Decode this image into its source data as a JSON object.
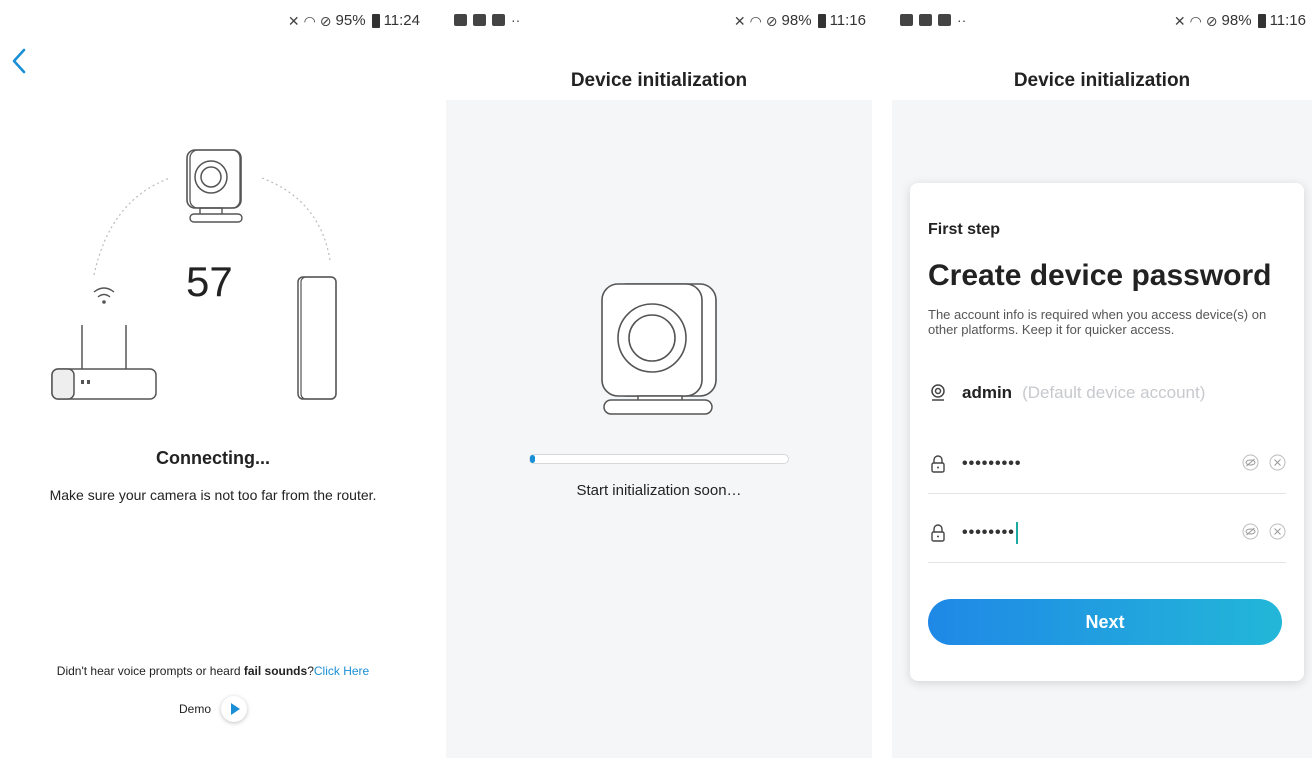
{
  "screen1": {
    "status": {
      "battery": "95%",
      "time": "11:24"
    },
    "countdown": "57",
    "connecting": "Connecting...",
    "hint": "Make sure your camera is not too far from the router.",
    "voice_prefix": "Didn't hear voice prompts or heard ",
    "voice_bold": "fail sounds",
    "voice_q": "?",
    "voice_link": "Click Here",
    "demo_label": "Demo"
  },
  "screen2": {
    "status": {
      "battery": "98%",
      "time": "11:16"
    },
    "title": "Device initialization",
    "progress": 0.02,
    "init_text": "Start initialization soon…"
  },
  "screen3": {
    "status": {
      "battery": "98%",
      "time": "11:16"
    },
    "title": "Device initialization",
    "step": "First step",
    "card_title": "Create device password",
    "desc": "The account info is required when you access device(s) on other platforms. Keep it for quicker access.",
    "account": {
      "name": "admin",
      "hint": "(Default device account)"
    },
    "password1": "•••••••••",
    "password2": "••••••••",
    "next_label": "Next"
  },
  "colors": {
    "accent": "#1a8fd6",
    "caret": "#1ca9a1",
    "gradient_start": "#1f88e6",
    "gradient_end": "#23b7d8"
  }
}
